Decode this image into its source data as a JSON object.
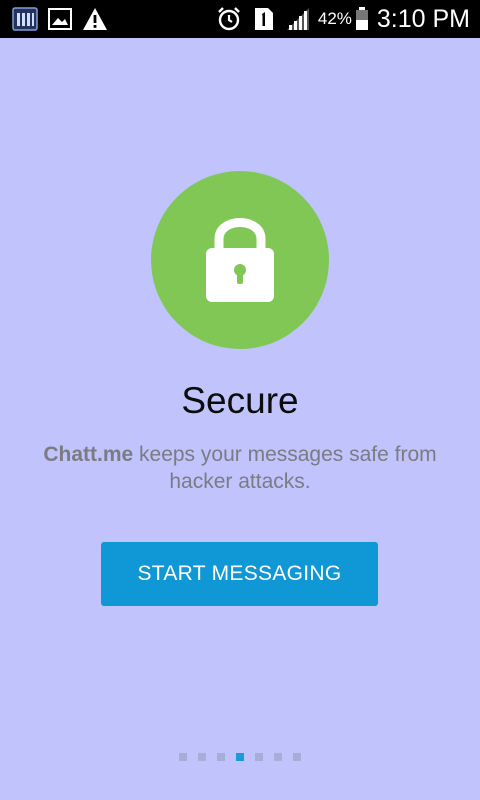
{
  "status_bar": {
    "icons": [
      "signal-bars-app-icon",
      "image-icon",
      "warning-icon",
      "alarm-icon",
      "sim-1-icon",
      "cell-signal-icon",
      "battery-icon"
    ],
    "battery_percent": "42%",
    "time": "3:10 PM"
  },
  "onboarding": {
    "icon": "lock-icon",
    "icon_circle_color": "#80c756",
    "title": "Secure",
    "description_brand": "Chatt.me",
    "description_rest": " keeps your messages safe from hacker attacks.",
    "button_label": "START MESSAGING",
    "button_color": "#0f98d5",
    "pager": {
      "total": 7,
      "active_index": 3
    }
  },
  "background_color": "#c0c3fc"
}
